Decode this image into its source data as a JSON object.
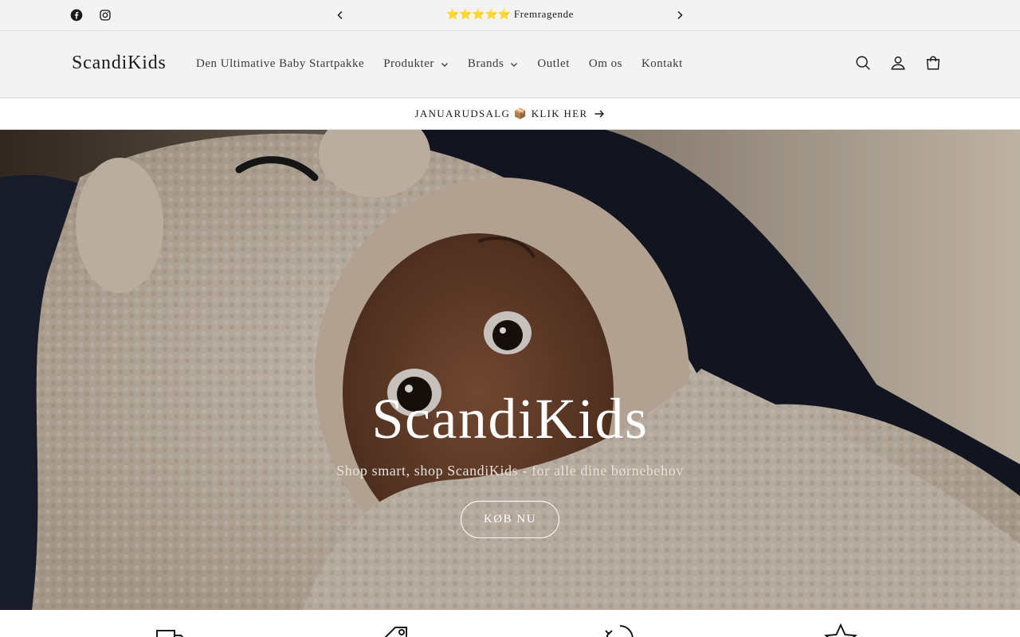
{
  "announcement": {
    "stars": "⭐⭐⭐⭐⭐",
    "text": "Fremragende"
  },
  "social": [
    {
      "icon": "facebook-icon"
    },
    {
      "icon": "instagram-icon"
    }
  ],
  "header": {
    "logo": "ScandiKids",
    "nav": [
      {
        "label": "Den Ultimative Baby Startpakke",
        "dropdown": false
      },
      {
        "label": "Produkter",
        "dropdown": true
      },
      {
        "label": "Brands",
        "dropdown": true
      },
      {
        "label": "Outlet",
        "dropdown": false
      },
      {
        "label": "Om os",
        "dropdown": false
      },
      {
        "label": "Kontakt",
        "dropdown": false
      }
    ],
    "icons": [
      "search-icon",
      "account-icon",
      "cart-icon"
    ]
  },
  "promo": {
    "text": "JANUARUDSALG 📦 KLIK HER"
  },
  "hero": {
    "title": "ScandiKids",
    "subtitle": "Shop smart, shop ScandiKids - for alle dine børnebehov",
    "button": "KØB NU"
  },
  "features": {
    "icons": [
      "delivery-truck-icon",
      "price-tag-icon",
      "return-arrow-icon",
      "star-icon"
    ]
  },
  "colors": {
    "background": "#f3f3f3",
    "text": "#1a1a1a",
    "stars": "#f5b800",
    "hero_text": "#ffffff"
  }
}
